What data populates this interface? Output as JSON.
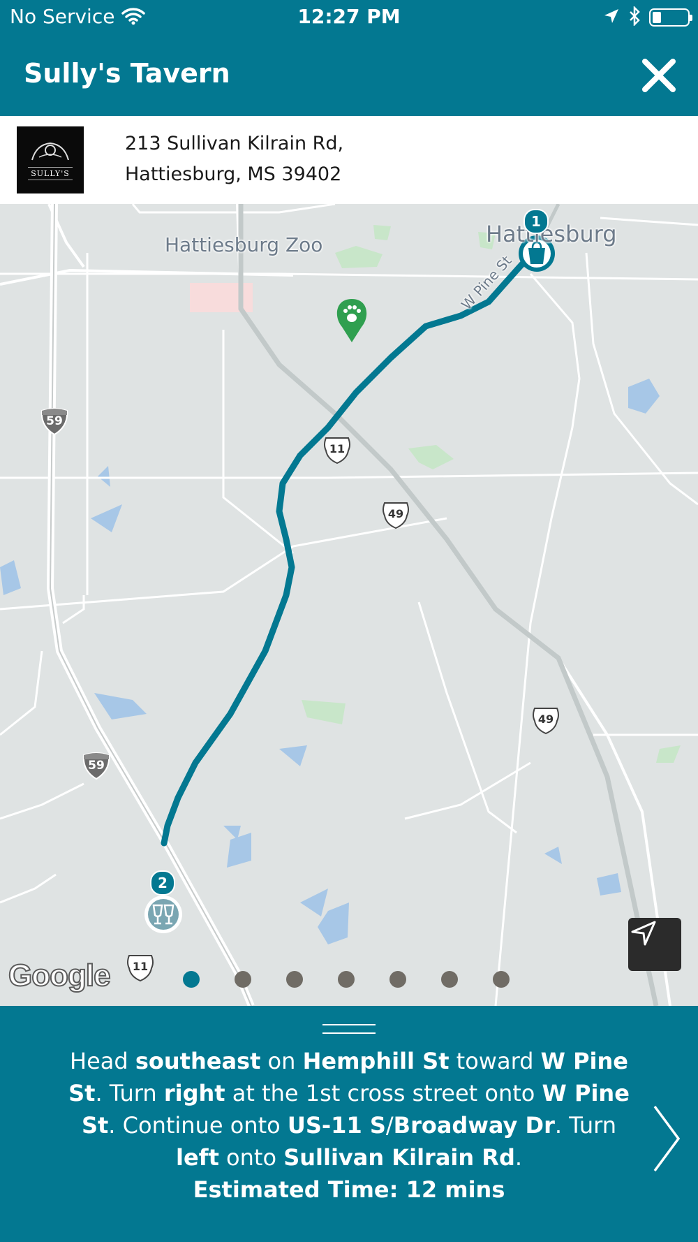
{
  "status_bar": {
    "carrier": "No Service",
    "time": "12:27 PM",
    "battery_level": 0.25
  },
  "header": {
    "title": "Sully's Tavern"
  },
  "venue": {
    "logo_text": "SULLY'S",
    "address_line1": "213 Sullivan Kilrain Rd,",
    "address_line2": "Hattiesburg, MS 39402"
  },
  "map": {
    "labels": {
      "zoo": "Hattiesburg Zoo",
      "city": "Hattiesburg",
      "street": "W Pine St"
    },
    "shields": {
      "i59_north": "59",
      "i59_south": "59",
      "us11_north": "11",
      "us11_south": "11",
      "us49_north": "49",
      "us49_south": "49"
    },
    "markers": {
      "start_number": "1",
      "end_number": "2"
    },
    "attribution": "Google",
    "page_dots": 7,
    "active_dot": 0
  },
  "directions": {
    "segments": [
      {
        "text": "Head ",
        "bold": false
      },
      {
        "text": "southeast",
        "bold": true
      },
      {
        "text": " on ",
        "bold": false
      },
      {
        "text": "Hemphill St",
        "bold": true
      },
      {
        "text": " toward ",
        "bold": false
      },
      {
        "text": "W Pine St",
        "bold": true
      },
      {
        "text": ". Turn ",
        "bold": false
      },
      {
        "text": "right",
        "bold": true
      },
      {
        "text": " at the 1st cross street onto ",
        "bold": false
      },
      {
        "text": "W Pine St",
        "bold": true
      },
      {
        "text": ". Continue onto ",
        "bold": false
      },
      {
        "text": "US-11 S",
        "bold": true
      },
      {
        "text": "/",
        "bold": false
      },
      {
        "text": "Broadway Dr",
        "bold": true
      },
      {
        "text": ". Turn ",
        "bold": false
      },
      {
        "text": "left",
        "bold": true
      },
      {
        "text": " onto ",
        "bold": false
      },
      {
        "text": "Sullivan Kilrain Rd",
        "bold": true
      },
      {
        "text": ".",
        "bold": false
      }
    ],
    "eta": "Estimated Time: 12 mins"
  },
  "colors": {
    "primary": "#037891",
    "map_bg": "#dfe3e3",
    "water": "#a7c7e7",
    "park": "#c8e6c9"
  }
}
